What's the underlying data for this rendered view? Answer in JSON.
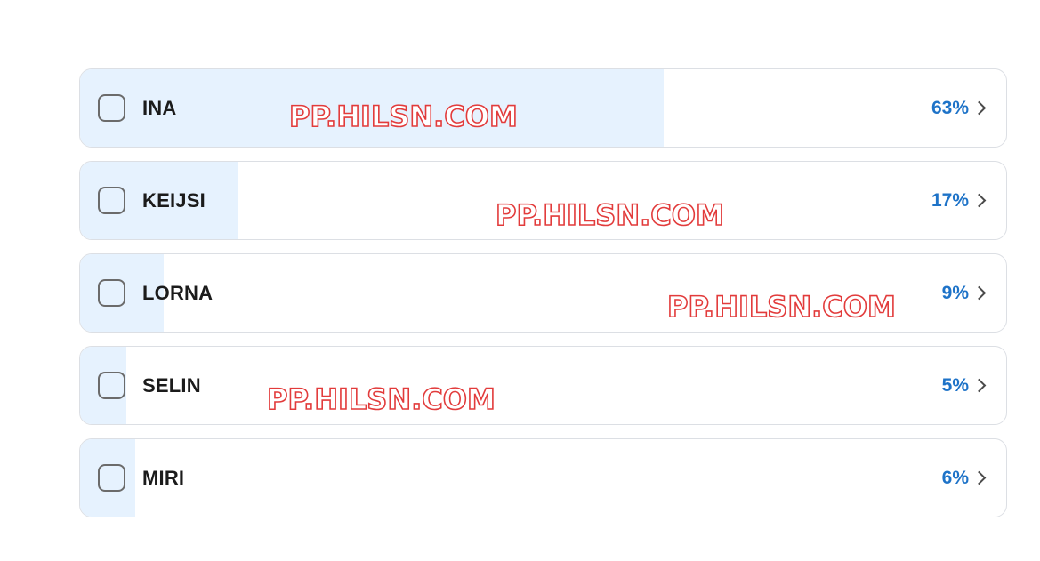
{
  "poll": {
    "options": [
      {
        "label": "INA",
        "percent_text": "63%",
        "fill_fraction": 0.63
      },
      {
        "label": "KEIJSI",
        "percent_text": "17%",
        "fill_fraction": 0.17
      },
      {
        "label": "LORNA",
        "percent_text": "9%",
        "fill_fraction": 0.09
      },
      {
        "label": "SELIN",
        "percent_text": "5%",
        "fill_fraction": 0.05
      },
      {
        "label": "MIRI",
        "percent_text": "6%",
        "fill_fraction": 0.06
      }
    ]
  },
  "watermark": {
    "text": "PP.HILSN.COM"
  },
  "colors": {
    "fill": "#e6f2fe",
    "percent": "#1e73c8",
    "watermark_outline": "#e23b3b"
  }
}
